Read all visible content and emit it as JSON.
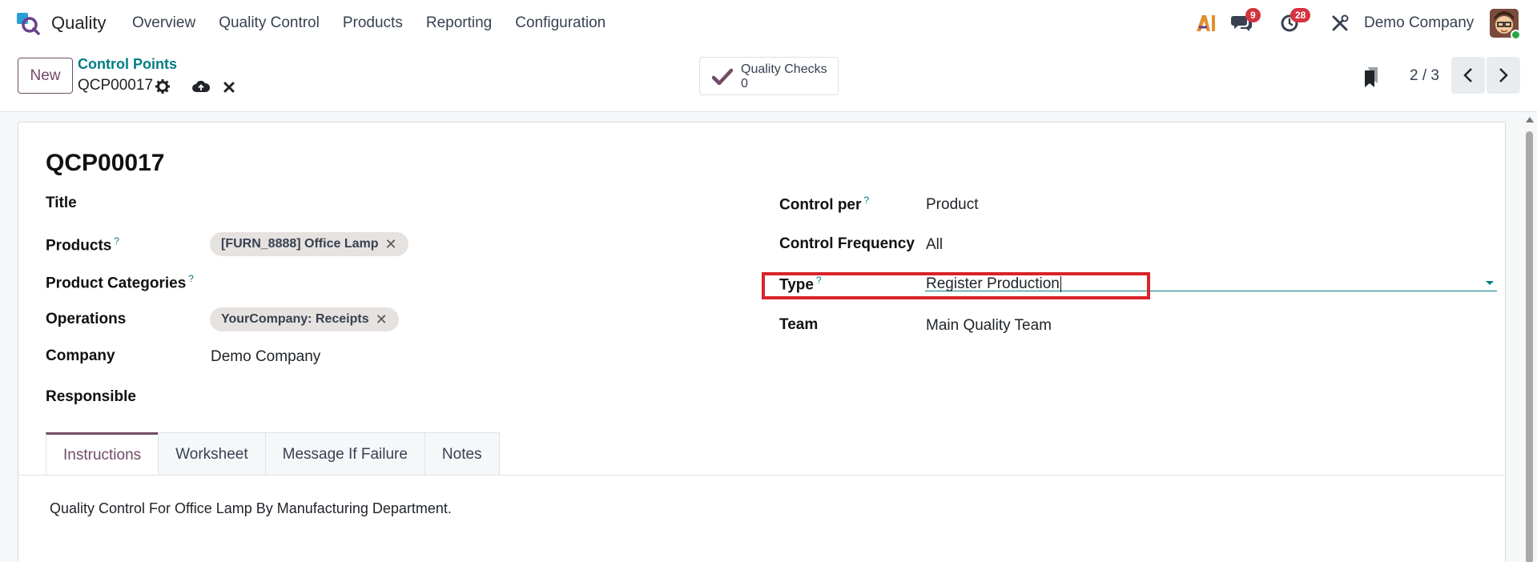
{
  "app": {
    "name": "Quality"
  },
  "menu": [
    "Overview",
    "Quality Control",
    "Products",
    "Reporting",
    "Configuration"
  ],
  "nav": {
    "messages_count": "9",
    "activities_count": "28",
    "company": "Demo Company"
  },
  "control": {
    "new_label": "New",
    "breadcrumb": "Control Points",
    "record_name": "QCP00017",
    "smart_button_label": "Quality Checks",
    "smart_button_count": "0",
    "pager": "2 / 3"
  },
  "form": {
    "title": "QCP00017",
    "left": {
      "title_label": "Title",
      "products_label": "Products",
      "products_tag": "[FURN_8888] Office Lamp",
      "categories_label": "Product Categories",
      "operations_label": "Operations",
      "operations_tag": "YourCompany: Receipts",
      "company_label": "Company",
      "company_value": "Demo Company",
      "responsible_label": "Responsible"
    },
    "right": {
      "control_per_label": "Control per",
      "control_per_value": "Product",
      "frequency_label": "Control Frequency",
      "frequency_value": "All",
      "type_label": "Type",
      "type_value": "Register Production",
      "team_label": "Team",
      "team_value": "Main Quality Team"
    },
    "help_mark": "?"
  },
  "tabs": [
    "Instructions",
    "Worksheet",
    "Message If Failure",
    "Notes"
  ],
  "instructions_text": "Quality Control For Office Lamp By Manufacturing Department.",
  "colors": {
    "brand": "#714b67",
    "link": "#017e84",
    "badge": "#d4343f",
    "highlight": "#d8232a"
  }
}
